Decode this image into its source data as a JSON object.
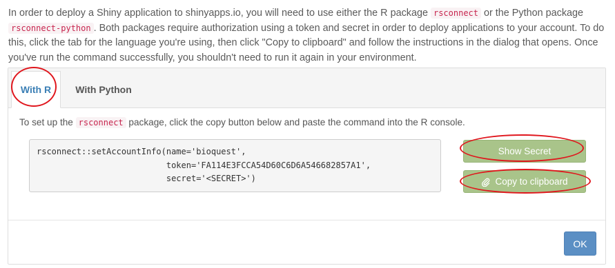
{
  "intro": {
    "part1": "In order to deploy a Shiny application to shinyapps.io, you will need to use either the R package ",
    "pkg_r": "rsconnect",
    "part2": " or the Python package ",
    "pkg_py": "rsconnect-python",
    "part3": ". Both packages require authorization using a token and secret in order to deploy applications to your account. To do this, click the tab for the language you're using, then click \"Copy to clipboard\" and follow the instructions in the dialog that opens. Once you've run the command successfully, you shouldn't need to run it again in your environment."
  },
  "tabs": [
    {
      "label": "With R",
      "active": true
    },
    {
      "label": "With Python",
      "active": false
    }
  ],
  "panel": {
    "desc_part1": "To set up the ",
    "desc_pkg": "rsconnect",
    "desc_part2": " package, click the copy button below and paste the command into the R console.",
    "code": "rsconnect::setAccountInfo(name='bioquest',\n                          token='FA114E3FCCA54D60C6D6A546682857A1',\n                          secret='<SECRET>')"
  },
  "buttons": {
    "show_secret": "Show Secret",
    "copy": "Copy to clipboard",
    "copy_icon": "paperclip-icon",
    "ok": "OK"
  },
  "colors": {
    "accent_green": "#a9c48a",
    "primary_blue": "#5b8fc4",
    "annotation_red": "#e0161d"
  }
}
